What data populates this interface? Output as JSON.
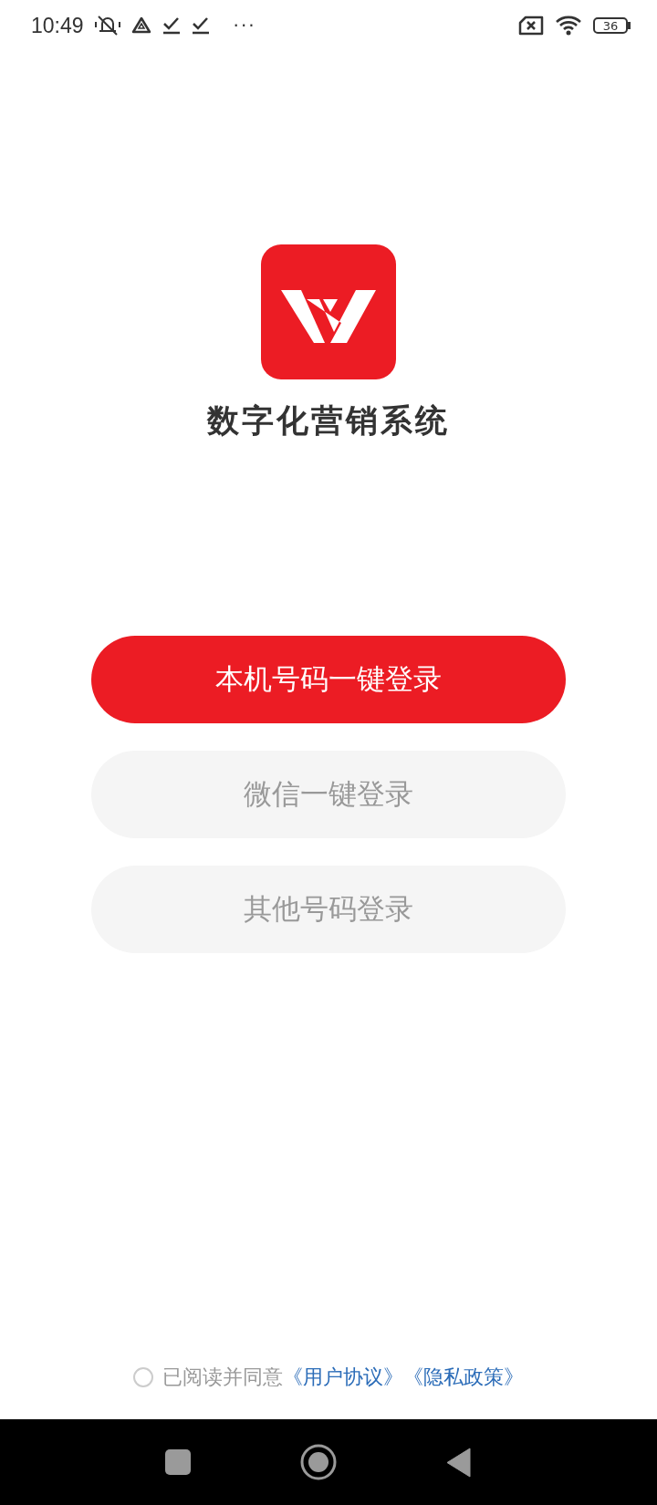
{
  "status_bar": {
    "time": "10:49",
    "more": "···",
    "battery": "36"
  },
  "app": {
    "name": "数字化营销系统"
  },
  "buttons": [
    {
      "label": "本机号码一键登录",
      "kind": "primary"
    },
    {
      "label": "微信一键登录",
      "kind": "secondary"
    },
    {
      "label": "其他号码登录",
      "kind": "secondary"
    }
  ],
  "agreement": {
    "checked": false,
    "text": "已阅读并同意",
    "links": [
      "《用户协议》",
      "《隐私政策》"
    ]
  }
}
